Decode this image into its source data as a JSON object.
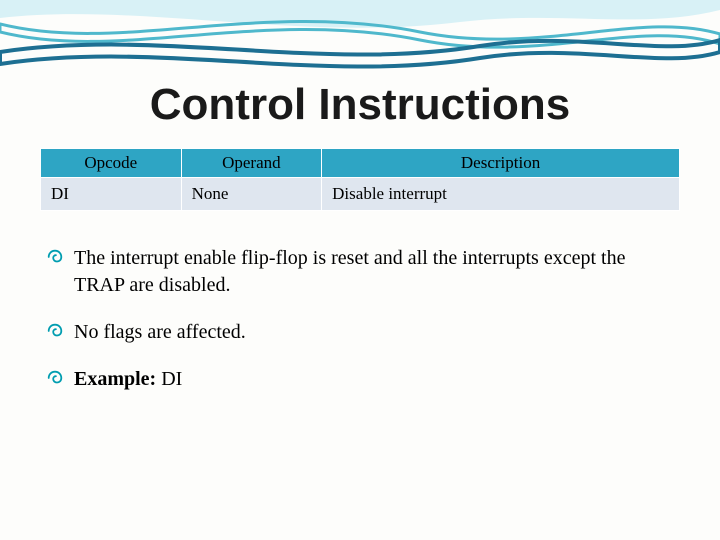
{
  "title": "Control Instructions",
  "table": {
    "headers": {
      "opcode": "Opcode",
      "operand": "Operand",
      "description": "Description"
    },
    "row": {
      "opcode": "DI",
      "operand": "None",
      "description": "Disable interrupt"
    }
  },
  "bullets": {
    "b1": "The interrupt enable flip-flop is reset and all the interrupts except the TRAP are disabled.",
    "b2": "No flags are affected.",
    "b3_label": "Example:",
    "b3_value": " DI"
  }
}
